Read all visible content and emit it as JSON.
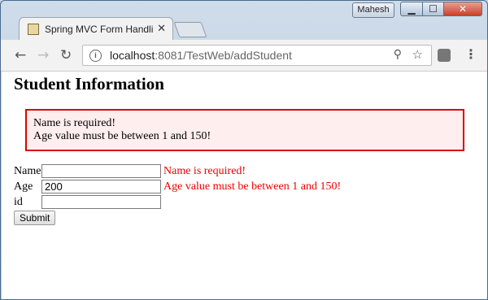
{
  "browser": {
    "tab_title": "Spring MVC Form Handli",
    "user_name": "Mahesh",
    "url_host": "localhost",
    "url_path": ":8081/TestWeb/addStudent"
  },
  "page": {
    "heading": "Student Information",
    "error_summary": [
      "Name is required!",
      "Age value must be between 1 and 150!"
    ],
    "form": {
      "name_label": "Name",
      "name_value": "",
      "name_error": "Name is required!",
      "age_label": "Age",
      "age_value": "200",
      "age_error": "Age value must be between 1 and 150!",
      "id_label": "id",
      "id_value": "",
      "submit_label": "Submit"
    }
  },
  "colors": {
    "error_red": "#e00000",
    "error_border": "#dd0000",
    "error_bg": "#ffeeee"
  }
}
